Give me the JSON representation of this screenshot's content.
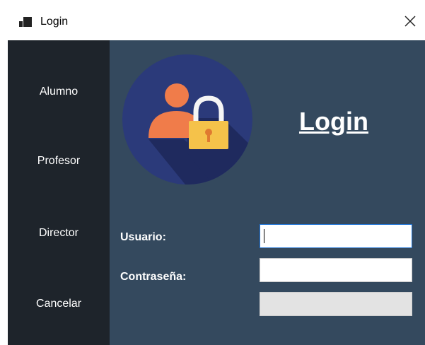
{
  "window": {
    "title": "Login"
  },
  "sidebar": {
    "items": [
      {
        "label": "Alumno"
      },
      {
        "label": "Profesor"
      },
      {
        "label": "Director"
      },
      {
        "label": "Cancelar"
      }
    ]
  },
  "main": {
    "heading": "Login",
    "usuario_label": "Usuario:",
    "contrasena_label": "Contraseña:",
    "usuario_value": "",
    "contrasena_value": "",
    "third_value": ""
  },
  "colors": {
    "sidebar": "#1e242b",
    "panel": "#34495e",
    "logo_circle": "#2b3a7a",
    "person": "#f07c4a",
    "lock": "#f5c24a"
  }
}
